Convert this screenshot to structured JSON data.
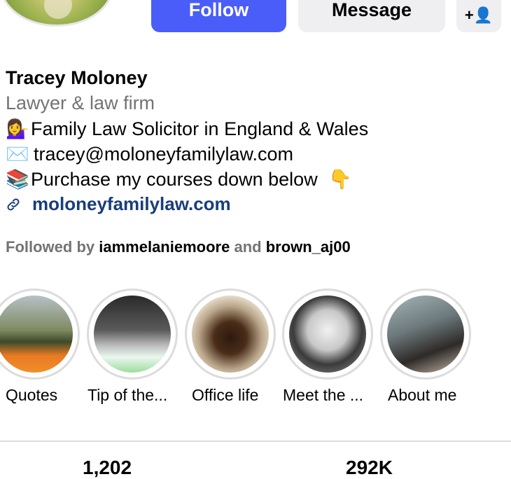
{
  "profile": {
    "name": "Tracey Moloney",
    "category": "Lawyer & law firm",
    "bio": {
      "line1_emoji": "💁‍♀️",
      "line1": "Family Law Solicitor in England & Wales",
      "line2_emoji": "✉️",
      "line2": "tracey@moloneyfamilylaw.com",
      "line3_emoji": "📚",
      "line3": "Purchase my courses down below",
      "line3_emoji_end": "👇"
    },
    "link": "moloneyfamilylaw.com"
  },
  "actions": {
    "follow": "Follow",
    "message": "Message",
    "add_user_icon": "+👤"
  },
  "followed_by": {
    "prefix": "Followed by",
    "user1": "iammelaniemoore",
    "conj": "and",
    "user2": "brown_aj00"
  },
  "highlights": [
    {
      "label": "Quotes"
    },
    {
      "label": "Tip of the..."
    },
    {
      "label": "Office life"
    },
    {
      "label": "Meet the ..."
    },
    {
      "label": "About me"
    }
  ],
  "stats": {
    "posts": "1,202",
    "followers": "292K"
  },
  "colors": {
    "follow_button": "#4a5df9",
    "link": "#1a3d7c",
    "secondary_text": "#737373"
  }
}
